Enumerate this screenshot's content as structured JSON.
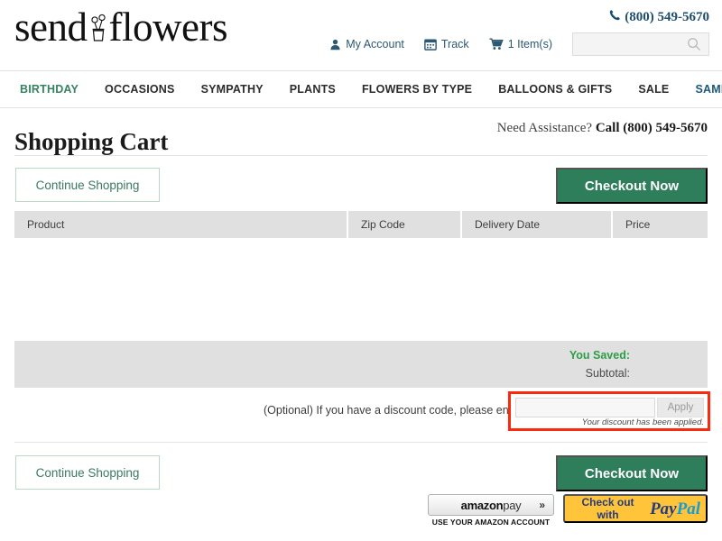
{
  "brand": {
    "logo_word_1": "send",
    "logo_word_2": "flowers",
    "logo_icon": "flower-vase-icon"
  },
  "header": {
    "phone_icon": "phone-icon",
    "phone": "(800) 549-5670",
    "links": [
      {
        "icon": "user-icon",
        "label": "My Account"
      },
      {
        "icon": "calendar-icon",
        "label": "Track"
      },
      {
        "icon": "cart-icon",
        "label": "1 Item(s)"
      }
    ],
    "search": {
      "value": "",
      "placeholder": "",
      "icon": "search-icon"
    }
  },
  "nav": {
    "items": [
      {
        "label": "BIRTHDAY",
        "style": "green"
      },
      {
        "label": "OCCASIONS",
        "style": "dark"
      },
      {
        "label": "SYMPATHY",
        "style": "dark"
      },
      {
        "label": "PLANTS",
        "style": "dark"
      },
      {
        "label": "FLOWERS BY TYPE",
        "style": "dark"
      },
      {
        "label": "BALLOONS & GIFTS",
        "style": "dark"
      },
      {
        "label": "SALE",
        "style": "dark"
      },
      {
        "label": "SAME DAY DELIVERY",
        "style": "blue"
      }
    ]
  },
  "page": {
    "title": "Shopping Cart",
    "assistance_prefix": "Need Assistance? ",
    "assistance_call": "Call (800) 549-5670"
  },
  "actions": {
    "continue_shopping": "Continue Shopping",
    "checkout_now": "Checkout Now"
  },
  "cart_table": {
    "columns": [
      "Product",
      "Zip Code",
      "Delivery Date",
      "Price"
    ],
    "rows": []
  },
  "totals": {
    "you_saved_label": "You Saved:",
    "you_saved_value": "",
    "subtotal_label": "Subtotal:",
    "subtotal_value": ""
  },
  "discount": {
    "prompt": "(Optional) If you have a discount code, please enter it here",
    "input_value": "",
    "input_placeholder": "",
    "apply_label": "Apply",
    "note": "Your discount has been applied.",
    "highlight_color": "#fc2a0c"
  },
  "payment": {
    "amazon_brand": "amazon",
    "amazon_pay": "pay",
    "amazon_chevrons": "»",
    "amazon_sub": "USE YOUR AMAZON ACCOUNT",
    "paypal_prefix": "Check out with",
    "paypal_pay": "Pay",
    "paypal_pal": "Pal"
  },
  "colors": {
    "brand_green": "#2e7d5b",
    "nav_green": "#35845f",
    "nav_blue": "#1c5878",
    "saved_green": "#2e9e46",
    "paypal_yellow": "#ffc439",
    "highlight_red": "#fc2a0c"
  }
}
